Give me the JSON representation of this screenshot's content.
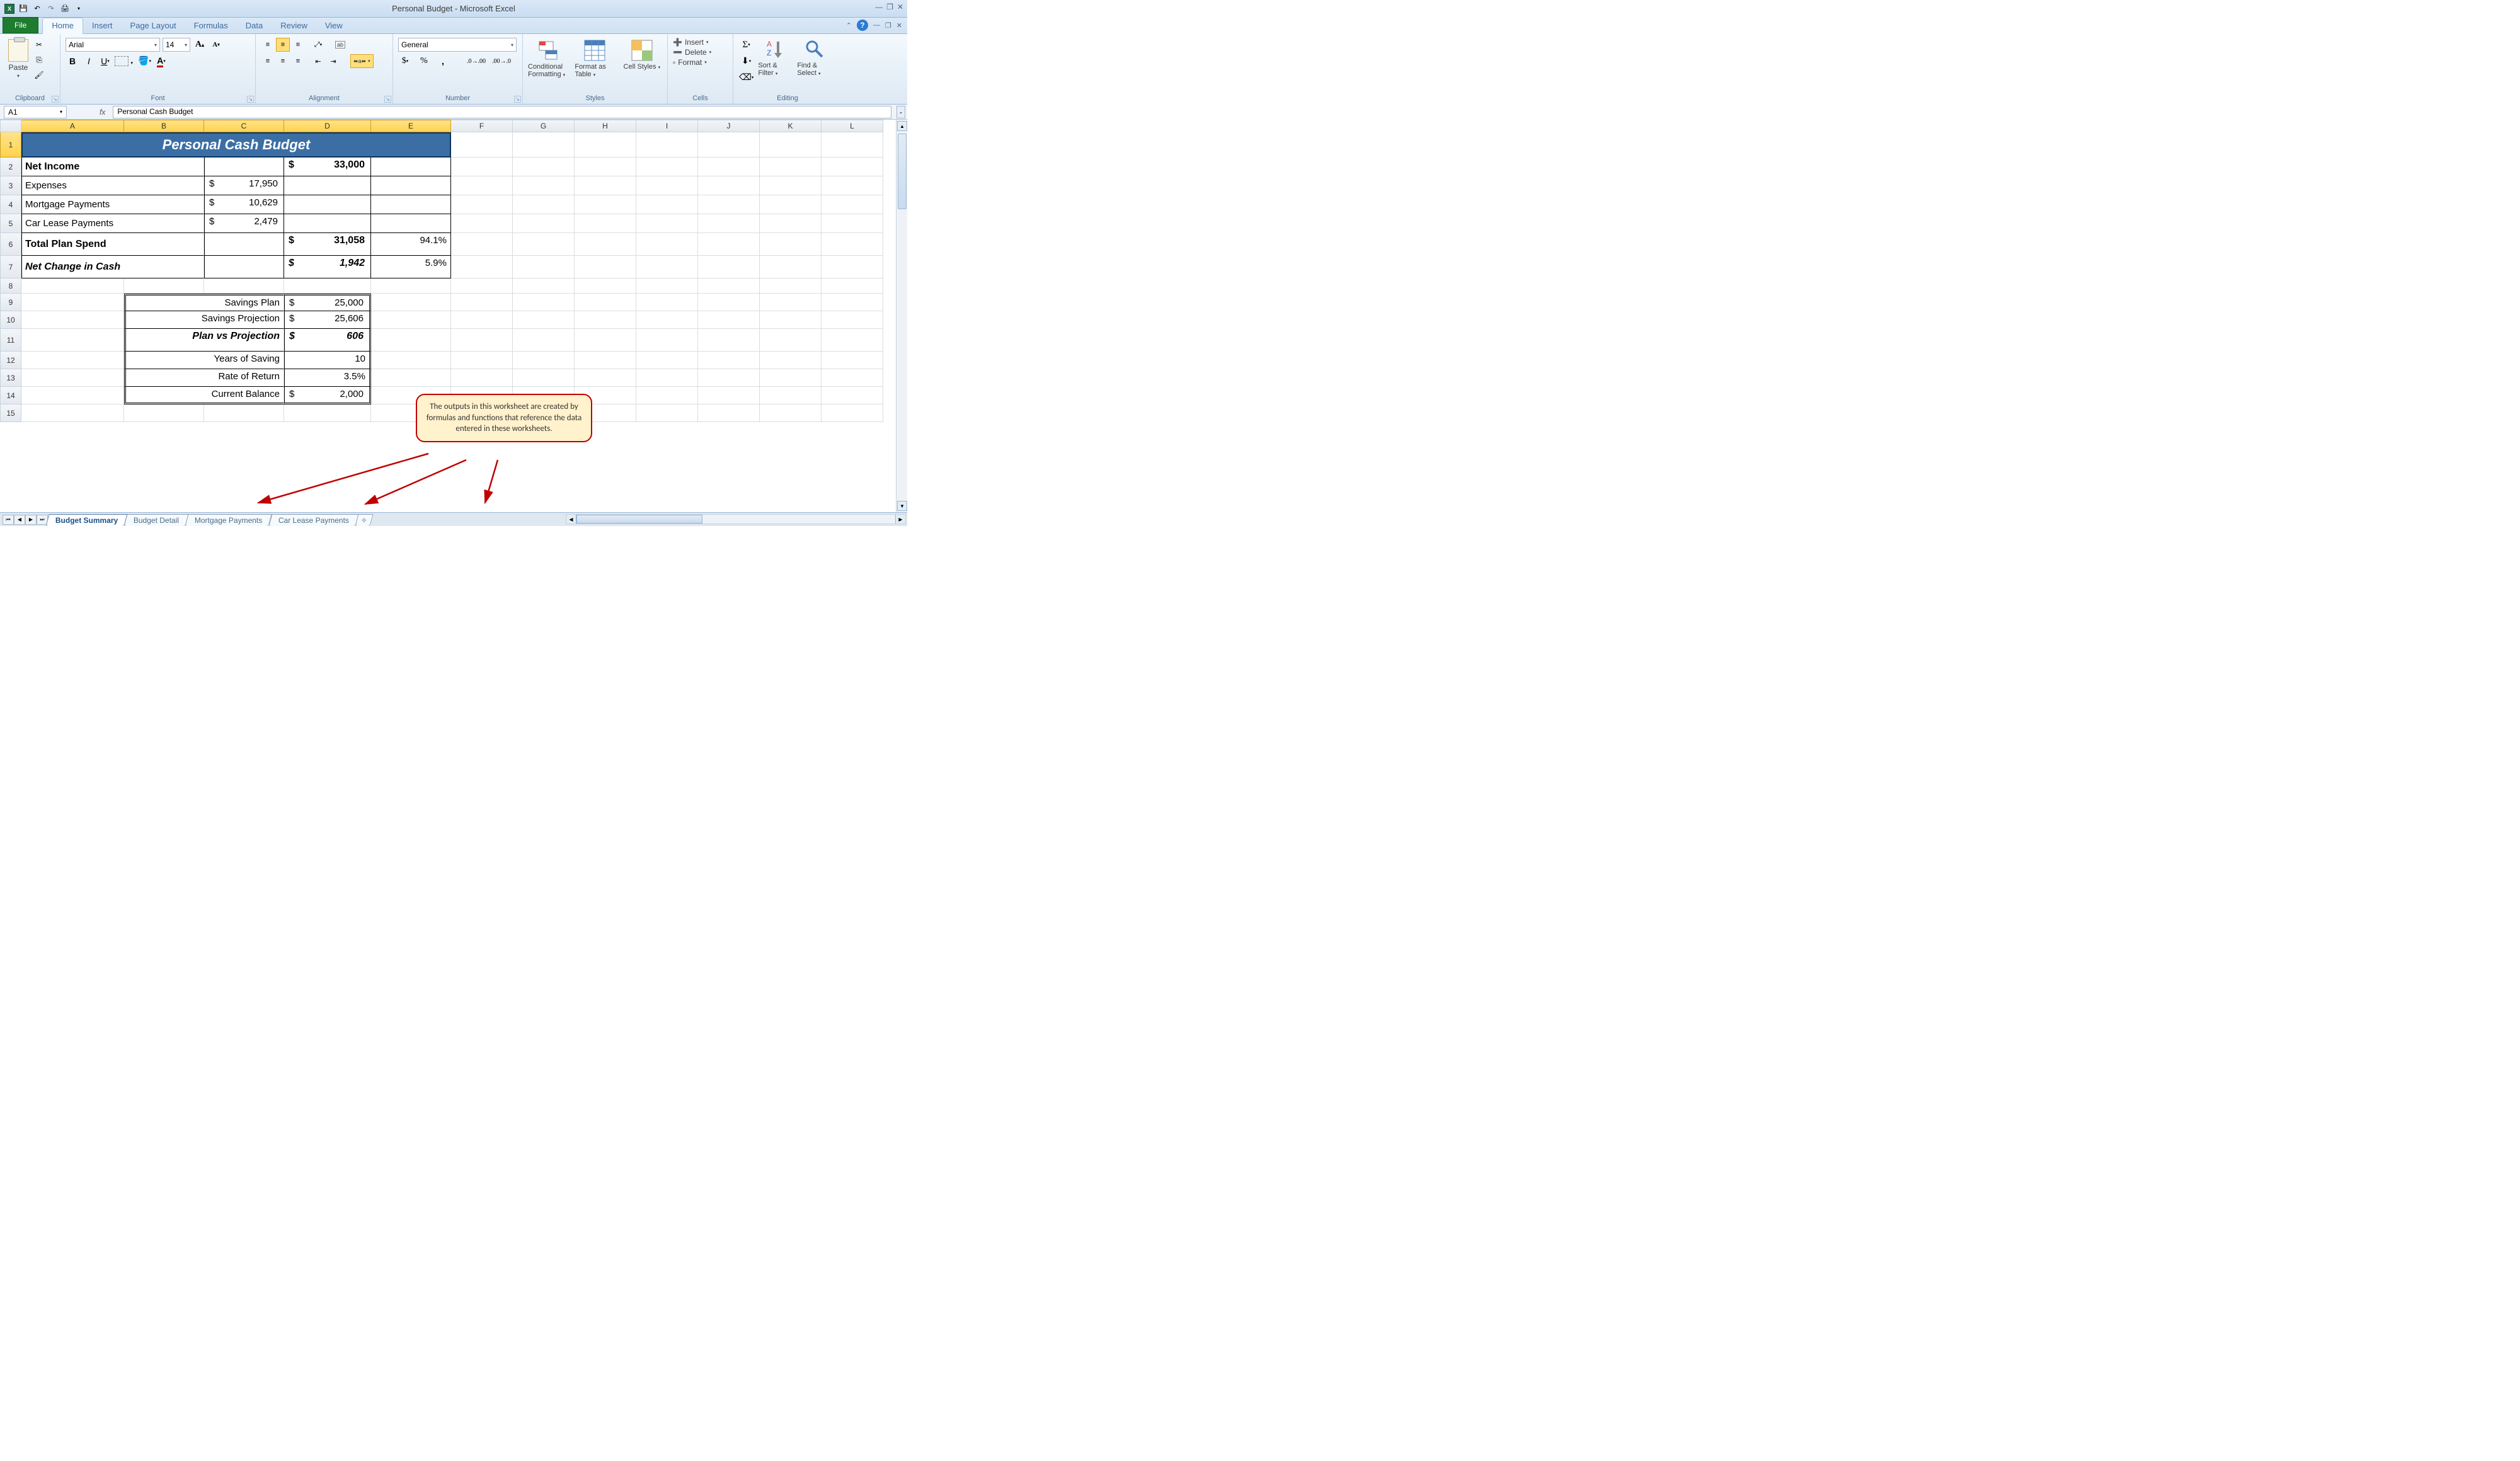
{
  "title": "Personal Budget - Microsoft Excel",
  "tabs": {
    "file": "File",
    "home": "Home",
    "insert": "Insert",
    "pagelayout": "Page Layout",
    "formulas": "Formulas",
    "data": "Data",
    "review": "Review",
    "view": "View"
  },
  "ribbon": {
    "clipboard": {
      "label": "Clipboard",
      "paste": "Paste"
    },
    "font": {
      "label": "Font",
      "name": "Arial",
      "size": "14"
    },
    "alignment": {
      "label": "Alignment"
    },
    "number": {
      "label": "Number",
      "format": "General"
    },
    "styles": {
      "label": "Styles",
      "cond": "Conditional Formatting",
      "table": "Format as Table",
      "cell": "Cell Styles"
    },
    "cells": {
      "label": "Cells",
      "insert": "Insert",
      "delete": "Delete",
      "format": "Format"
    },
    "editing": {
      "label": "Editing",
      "sort": "Sort & Filter",
      "find": "Find & Select"
    }
  },
  "namebox": "A1",
  "formula": "Personal Cash Budget",
  "cols": [
    "A",
    "B",
    "C",
    "D",
    "E",
    "F",
    "G",
    "H",
    "I",
    "J",
    "K",
    "L"
  ],
  "rownums": [
    "1",
    "2",
    "3",
    "4",
    "5",
    "6",
    "7",
    "8",
    "9",
    "10",
    "11",
    "12",
    "13",
    "14",
    "15"
  ],
  "chart_data": {
    "type": "table",
    "title": "Personal Cash Budget",
    "rows": [
      {
        "label": "Net Income",
        "c": "",
        "d": "$   33,000",
        "e": "",
        "bold": true
      },
      {
        "label": "Expenses",
        "c": "$  17,950",
        "d": "",
        "e": ""
      },
      {
        "label": "Mortgage Payments",
        "c": "$  10,629",
        "d": "",
        "e": ""
      },
      {
        "label": "Car Lease Payments",
        "c": "$    2,479",
        "d": "",
        "e": ""
      },
      {
        "label": "Total Plan Spend",
        "c": "",
        "d": "$   31,058",
        "e": "94.1%",
        "bold": true
      },
      {
        "label": "Net Change in Cash",
        "c": "",
        "d": "$     1,942",
        "e": "5.9%",
        "bi": true
      }
    ],
    "box": [
      {
        "label": "Savings Plan",
        "d": "$   25,000"
      },
      {
        "label": "Savings Projection",
        "d": "$   25,606"
      },
      {
        "label": "Plan vs Projection",
        "d": "$        606",
        "bi": true
      },
      {
        "label": "",
        "d": ""
      },
      {
        "label": "Years of Saving",
        "d": "10"
      },
      {
        "label": "Rate of Return",
        "d": "3.5%"
      },
      {
        "label": "Current Balance",
        "d": "$     2,000"
      }
    ]
  },
  "box_labels": {
    "sp": "Savings Plan",
    "sj": "Savings Projection",
    "pvp": "Plan vs Projection",
    "ys": "Years of Saving",
    "rr": "Rate of Return",
    "cb": "Current Balance"
  },
  "box_vals": {
    "sp_s": "$",
    "sp_v": "25,000",
    "sj_s": "$",
    "sj_v": "25,606",
    "pvp_s": "$",
    "pvp_v": "606",
    "ys": "10",
    "rr": "3.5%",
    "cb_s": "$",
    "cb_v": "2,000"
  },
  "main_labels": {
    "ni": "Net Income",
    "ex": "Expenses",
    "mp": "Mortgage Payments",
    "clp": "Car Lease Payments",
    "tps": "Total Plan Spend",
    "ncc": "Net Change in Cash"
  },
  "main_vals": {
    "ni_d_s": "$",
    "ni_d_v": "33,000",
    "ex_c_s": "$",
    "ex_c_v": "17,950",
    "mp_c_s": "$",
    "mp_c_v": "10,629",
    "clp_c_s": "$",
    "clp_c_v": "2,479",
    "tps_d_s": "$",
    "tps_d_v": "31,058",
    "tps_e": "94.1%",
    "ncc_d_s": "$",
    "ncc_d_v": "1,942",
    "ncc_e": "5.9%"
  },
  "callout": "The outputs in this worksheet are created by formulas and functions that reference the data entered in these worksheets.",
  "sheets": [
    "Budget Summary",
    "Budget Detail",
    "Mortgage Payments",
    "Car Lease Payments"
  ]
}
